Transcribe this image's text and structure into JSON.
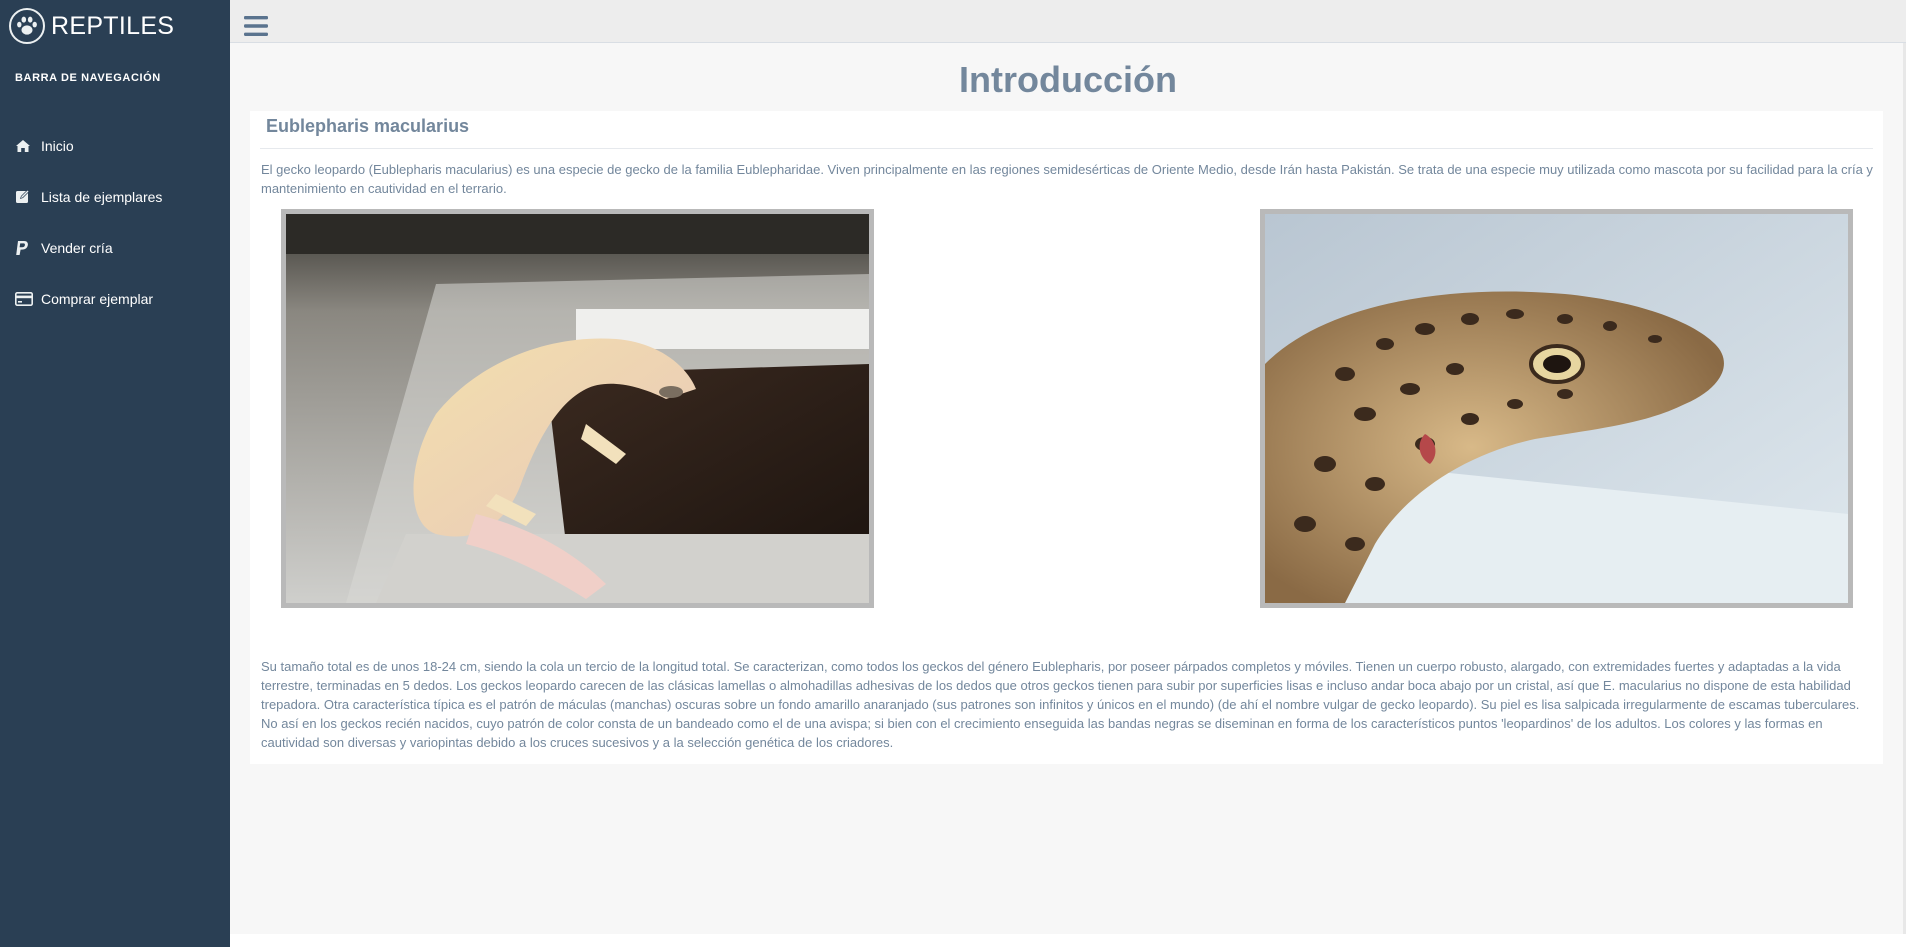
{
  "brand": {
    "title": "REPTILES",
    "icon": "paw-icon"
  },
  "sidebar": {
    "heading": "BARRA DE NAVEGACIÓN",
    "items": [
      {
        "label": "Inicio",
        "icon": "home-icon"
      },
      {
        "label": "Lista de ejemplares",
        "icon": "edit-icon"
      },
      {
        "label": "Vender cría",
        "icon": "paypal-icon"
      },
      {
        "label": "Comprar ejemplar",
        "icon": "credit-card-icon"
      }
    ]
  },
  "topbar": {
    "menu_icon": "hamburger-icon"
  },
  "main": {
    "page_title": "Introducción",
    "panel": {
      "title": "Eublepharis macularius",
      "paragraph1": "El gecko leopardo (Eublepharis macularius) es una especie de gecko de la familia Eublepharidae. Viven principalmente en las regiones semidesérticas de Oriente Medio, desde Irán hasta Pakistán. Se trata de una especie muy utilizada como mascota por su facilidad para la cría y mantenimiento en cautividad en el terrario.",
      "paragraph2": "Su tamaño total es de unos 18-24 cm, siendo la cola un tercio de la longitud total. Se caracterizan, como todos los geckos del género Eublepharis, por poseer párpados completos y móviles. Tienen un cuerpo robusto, alargado, con extremidades fuertes y adaptadas a la vida terrestre, terminadas en 5 dedos. Los geckos leopardo carecen de las clásicas lamellas o almohadillas adhesivas de los dedos que otros geckos tienen para subir por superficies lisas e incluso andar boca abajo por un cristal, así que E. macularius no dispone de esta habilidad trepadora. Otra característica típica es el patrón de máculas (manchas) oscuras sobre un fondo amarillo anaranjado (sus patrones son infinitos y únicos en el mundo) (de ahí el nombre vulgar de gecko leopardo). Su piel es lisa salpicada irregularmente de escamas tuberculares. No así en los geckos recién nacidos, cuyo patrón de color consta de un bandeado como el de una avispa; si bien con el crecimiento enseguida las bandas negras se diseminan en forma de los característicos puntos 'leopardinos' de los adultos. Los colores y las formas en cautividad son diversas y variopintas debido a los cruces sucesivos y a la selección genética de los criadores."
    }
  },
  "colors": {
    "sidebar_bg": "#2a3f54",
    "text_muted": "#73879c",
    "topbar_bg": "#ededed",
    "content_bg": "#f7f7f7"
  }
}
